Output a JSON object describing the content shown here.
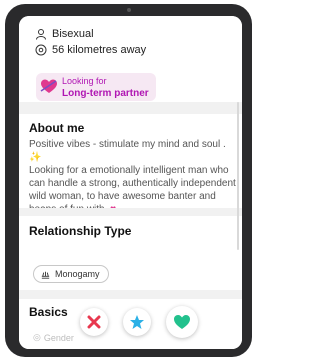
{
  "profile": {
    "orientation": "Bisexual",
    "distance": "56 kilometres away"
  },
  "looking_for": {
    "label": "Looking for",
    "value": "Long-term partner"
  },
  "about": {
    "heading": "About me",
    "line1": "Positive vibes - stimulate my mind and soul .",
    "body": "Looking for a emotionally intelligent man who can handle a strong, authentically independent wild woman, to have awesome banter and heaps of fun with."
  },
  "relationship": {
    "heading": "Relationship Type",
    "chip": "Monogamy"
  },
  "basics": {
    "heading": "Basics",
    "gender_label": "Gender"
  },
  "actions": {
    "pass_color": "#e8384f",
    "super_color": "#2bb0e6",
    "like_color": "#22c18d"
  }
}
